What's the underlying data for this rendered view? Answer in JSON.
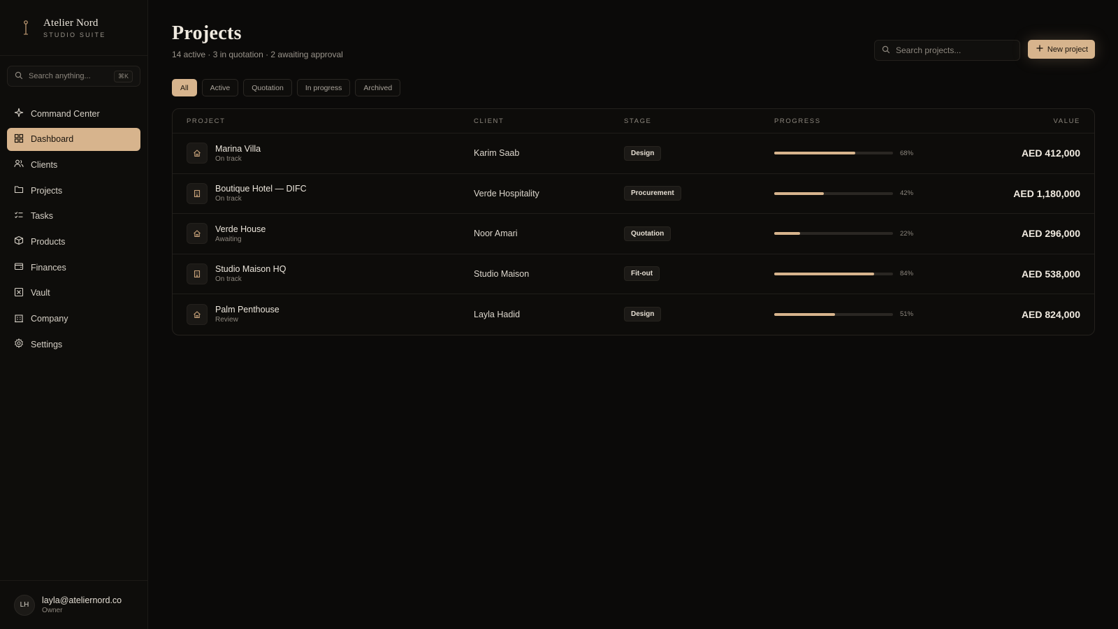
{
  "brand": {
    "name": "Atelier Nord",
    "subtitle": "STUDIO SUITE"
  },
  "sidebar": {
    "search_placeholder": "Search anything...",
    "shortcut": "⌘K",
    "items": [
      {
        "label": "Command Center",
        "icon": "sparkle-icon"
      },
      {
        "label": "Dashboard",
        "icon": "grid-icon",
        "active": true
      },
      {
        "label": "Clients",
        "icon": "users-icon"
      },
      {
        "label": "Projects",
        "icon": "folder-icon"
      },
      {
        "label": "Tasks",
        "icon": "checklist-icon"
      },
      {
        "label": "Products",
        "icon": "box-icon"
      },
      {
        "label": "Finances",
        "icon": "wallet-icon"
      },
      {
        "label": "Vault",
        "icon": "vault-icon"
      },
      {
        "label": "Company",
        "icon": "building-icon"
      },
      {
        "label": "Settings",
        "icon": "gear-icon"
      }
    ]
  },
  "user": {
    "initials": "LH",
    "email": "layla@ateliernord.co",
    "role": "Owner"
  },
  "page": {
    "title": "Projects",
    "subtitle": "14 active · 3 in quotation · 2 awaiting approval",
    "search_placeholder": "Search projects...",
    "new_button": "New project"
  },
  "filters": [
    "All",
    "Active",
    "Quotation",
    "In progress",
    "Archived"
  ],
  "active_filter": "All",
  "table": {
    "columns": [
      "PROJECT",
      "CLIENT",
      "STAGE",
      "PROGRESS",
      "VALUE"
    ],
    "rows": [
      {
        "name": "Marina Villa",
        "status": "On track",
        "icon": "home-icon",
        "client": "Karim Saab",
        "stage": "Design",
        "progress": 68,
        "progress_label": "68%",
        "value": "AED 412,000"
      },
      {
        "name": "Boutique Hotel — DIFC",
        "status": "On track",
        "icon": "building-icon",
        "client": "Verde Hospitality",
        "stage": "Procurement",
        "progress": 42,
        "progress_label": "42%",
        "value": "AED 1,180,000"
      },
      {
        "name": "Verde House",
        "status": "Awaiting",
        "icon": "home-icon",
        "client": "Noor Amari",
        "stage": "Quotation",
        "progress": 22,
        "progress_label": "22%",
        "value": "AED 296,000"
      },
      {
        "name": "Studio Maison HQ",
        "status": "On track",
        "icon": "building-icon",
        "client": "Studio Maison",
        "stage": "Fit-out",
        "progress": 84,
        "progress_label": "84%",
        "value": "AED 538,000"
      },
      {
        "name": "Palm Penthouse",
        "status": "Review",
        "icon": "home-icon",
        "client": "Layla Hadid",
        "stage": "Design",
        "progress": 51,
        "progress_label": "51%",
        "value": "AED 824,000"
      }
    ]
  },
  "colors": {
    "accent": "#d7b48d",
    "background": "#0b0a09",
    "sidebar": "#0e0d0b"
  }
}
